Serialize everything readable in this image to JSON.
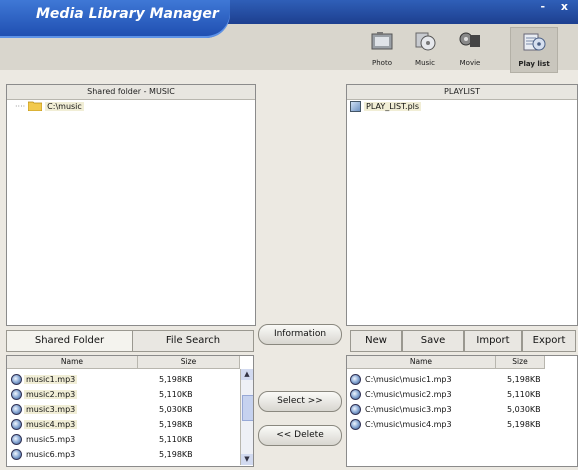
{
  "app": {
    "title": "Media Library Manager",
    "window_controls": "- x"
  },
  "modes": [
    {
      "label": "Photo",
      "icon": "photo-icon",
      "active": false
    },
    {
      "label": "Music",
      "icon": "music-icon",
      "active": false
    },
    {
      "label": "Movie",
      "icon": "movie-icon",
      "active": false
    },
    {
      "label": "Play list",
      "icon": "playlist-icon",
      "active": true
    }
  ],
  "left_panel": {
    "header": "Shared folder - MUSIC",
    "tree_item": "C:\\music"
  },
  "right_panel": {
    "header": "PLAYLIST",
    "item": "PLAY_LIST.pls"
  },
  "left_tabs": {
    "shared_folder": "Shared Folder",
    "file_search": "File Search"
  },
  "middle": {
    "information": "Information",
    "select": "Select >>",
    "delete": "<< Delete"
  },
  "playlist_buttons": {
    "new": "New",
    "save": "Save",
    "import": "Import",
    "export": "Export"
  },
  "file_list": {
    "columns": {
      "name": "Name",
      "size": "Size"
    },
    "rows": [
      {
        "name": "music1.mp3",
        "size": "5,198KB"
      },
      {
        "name": "music2.mp3",
        "size": "5,110KB"
      },
      {
        "name": "music3.mp3",
        "size": "5,030KB"
      },
      {
        "name": "music4.mp3",
        "size": "5,198KB"
      },
      {
        "name": "music5.mp3",
        "size": "5,110KB"
      },
      {
        "name": "music6.mp3",
        "size": "5,198KB"
      }
    ]
  },
  "playlist_list": {
    "columns": {
      "name": "Name",
      "size": "Size"
    },
    "rows": [
      {
        "name": "C:\\music\\music1.mp3",
        "size": "5,198KB"
      },
      {
        "name": "C:\\music\\music2.mp3",
        "size": "5,110KB"
      },
      {
        "name": "C:\\music\\music3.mp3",
        "size": "5,030KB"
      },
      {
        "name": "C:\\music\\music4.mp3",
        "size": "5,198KB"
      }
    ]
  }
}
